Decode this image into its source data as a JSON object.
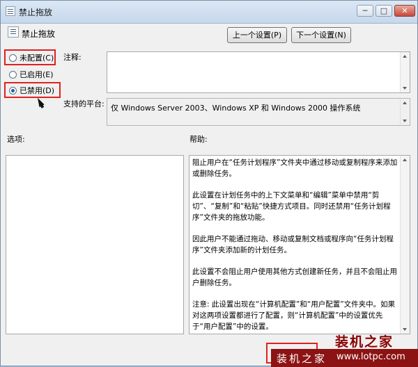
{
  "window": {
    "title": "禁止拖放",
    "controls": {
      "minimize": "─",
      "maximize": "□",
      "close": "✕"
    }
  },
  "header": {
    "title": "禁止拖放",
    "prev_setting": "上一个设置(P)",
    "next_setting": "下一个设置(N)"
  },
  "options": {
    "not_configured": "未配置(C)",
    "enabled": "已启用(E)",
    "disabled": "已禁用(D)",
    "selected": "disabled"
  },
  "comment": {
    "label": "注释:",
    "value": ""
  },
  "platform": {
    "label": "支持的平台:",
    "value": "仅 Windows Server 2003、Windows XP 和 Windows 2000 操作系统"
  },
  "sections": {
    "options_label": "选项:",
    "help_label": "帮助:"
  },
  "help": {
    "paragraphs": [
      "阻止用户在“任务计划程序”文件夹中通过移动或复制程序来添加或删除任务。",
      "此设置在计划任务中的上下文菜单和“编辑”菜单中禁用“剪切”、“复制”和“粘贴”快捷方式项目。同时还禁用“任务计划程序”文件夹的拖放功能。",
      "因此用户不能通过拖动、移动或复制文档或程序向“任务计划程序”文件夹添加新的计划任务。",
      "此设置不会阻止用户使用其他方式创建新任务，并且不会阻止用户删除任务。",
      "注意: 此设置出现在“计算机配置”和“用户配置”文件夹中。如果对这两项设置都进行了配置，则“计算机配置”中的设置优先于“用户配置”中的设置。"
    ]
  },
  "watermark": {
    "top": "装机之家",
    "bottom_left": "装机之家",
    "bottom_right": "www.lotpc.com"
  },
  "colors": {
    "highlight": "#e02020",
    "accent": "#1f5fa8",
    "watermark_bg": "#8b1313"
  }
}
